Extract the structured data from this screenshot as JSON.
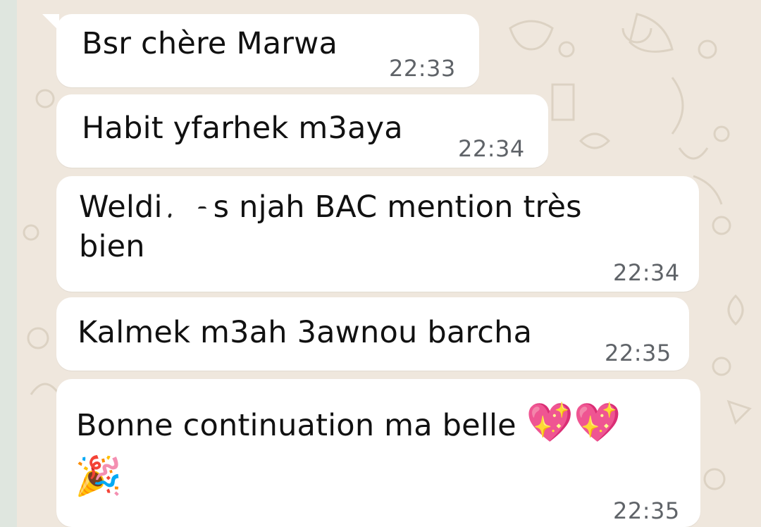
{
  "colors": {
    "background": "#efe7dd",
    "bubble": "#ffffff",
    "text": "#111111",
    "timestamp": "#5f6368"
  },
  "messages": [
    {
      "text": "Bsr chère Marwa",
      "time": "22:33"
    },
    {
      "text": "Habit yfarhek m3aya",
      "time": "22:34"
    },
    {
      "line1_pre": "Weldi",
      "line1_post": "s njah BAC mention très",
      "line2": "bien",
      "time": "22:34"
    },
    {
      "text": "Kalmek m3ah 3awnou barcha",
      "time": "22:35"
    },
    {
      "text": "Bonne continuation ma belle",
      "emoji_hearts": "💖💖",
      "emoji_party": "🎉",
      "time": "22:35"
    }
  ]
}
